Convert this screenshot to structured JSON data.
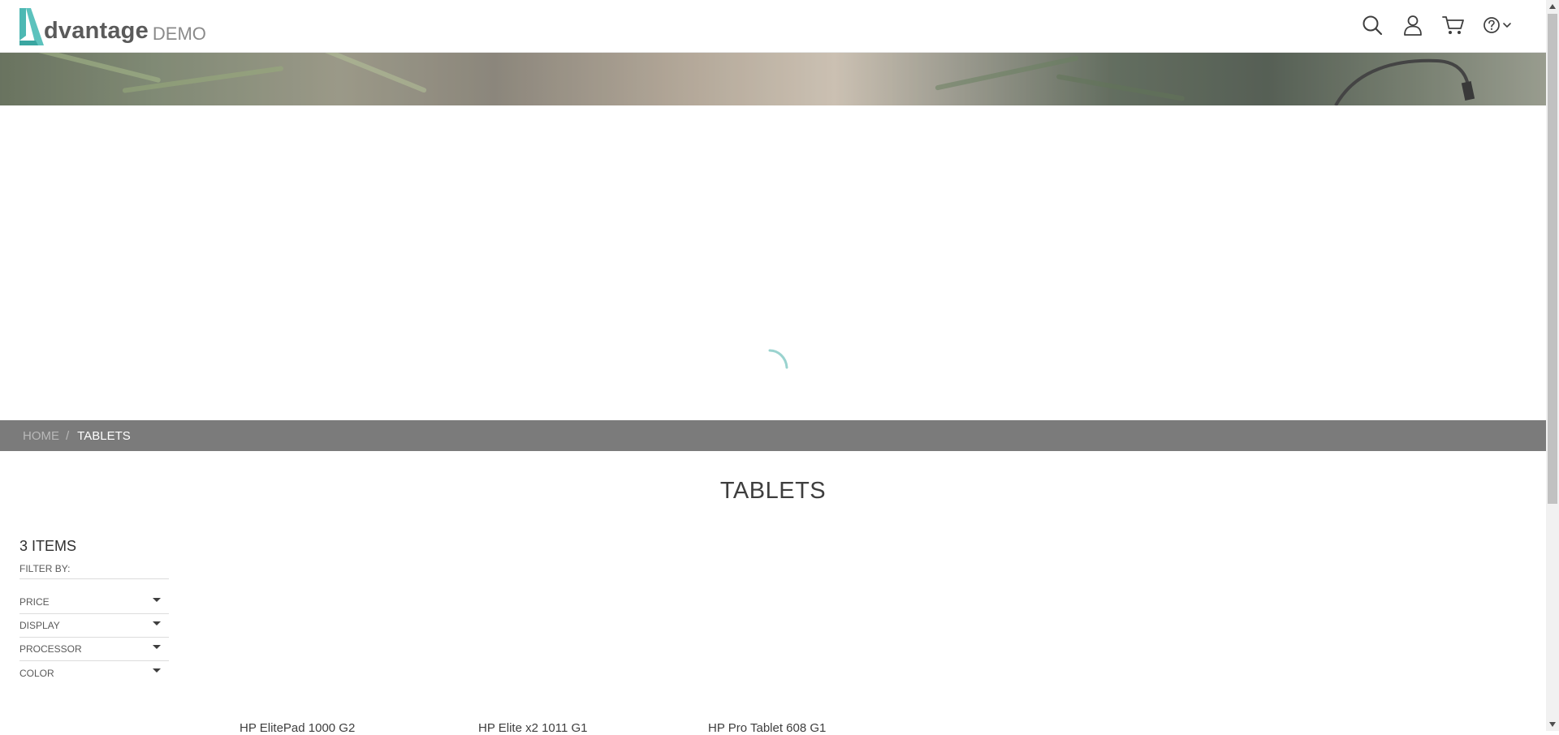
{
  "header": {
    "logo_word": "dvantage",
    "logo_demo": "DEMO",
    "icons": [
      "search-icon",
      "user-icon",
      "cart-icon",
      "help-icon"
    ]
  },
  "breadcrumb": {
    "home": "HOME",
    "separator": "/",
    "current": "TABLETS"
  },
  "page": {
    "title": "TABLETS",
    "items_count": "3 ITEMS",
    "filter_by": "FILTER BY:"
  },
  "filters": [
    {
      "label": "PRICE"
    },
    {
      "label": "DISPLAY"
    },
    {
      "label": "PROCESSOR"
    },
    {
      "label": "COLOR"
    }
  ],
  "products": [
    {
      "name": "HP ElitePad 1000 G2"
    },
    {
      "name": "HP Elite x2 1011 G1"
    },
    {
      "name": "HP Pro Tablet 608 G1"
    }
  ],
  "colors": {
    "brand_teal": "#4db8b3",
    "breadcrumb_bar": "#7b7b7b"
  }
}
